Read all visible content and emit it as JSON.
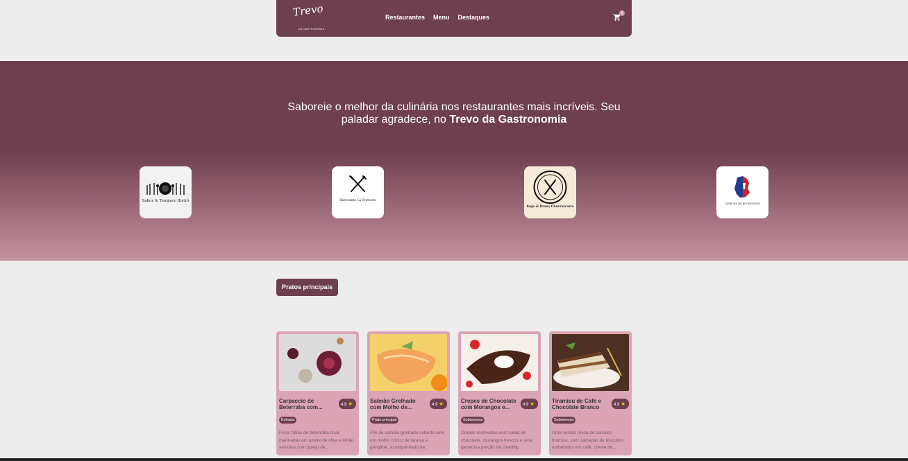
{
  "brand": {
    "script": "Trevo",
    "subtitle": "DA GASTRONOMIA"
  },
  "nav": {
    "items": [
      "Restaurantes",
      "Menu",
      "Destaques"
    ]
  },
  "cart": {
    "count": "0"
  },
  "hero": {
    "text_prefix": "Saboreie o melhor da culinária nos restaurantes mais incríveis. Seu paladar agradece, no ",
    "text_bold": "Trevo da Gastronomia"
  },
  "restaurants": [
    {
      "name": "Sabor & Tempero Bistrô"
    },
    {
      "name": "Ristorante La Trattoria"
    },
    {
      "name": "Fogo & Brasa Churrascaria"
    },
    {
      "name": "SAVEURS DE BOURGOGNE"
    }
  ],
  "section_tab": {
    "label": "Pratos principais"
  },
  "dishes": [
    {
      "title": "Carpaccio de Beterraba com...",
      "rating": "4.9",
      "tag": "Entrada",
      "desc": "Finas fatias de beterraba crua marinadas em azeite de oliva e limão, servidas com queijo de..."
    },
    {
      "title": "Salmão Grelhado com Molho de...",
      "rating": "4.9",
      "tag": "Prato principal",
      "desc": "Filé de salmão grelhado coberto com um molho cítrico de laranja e gengibre, acompanhado de..."
    },
    {
      "title": "Crepes de Chocolate com Morangos e...",
      "rating": "4.9",
      "tag": "Sobremesa",
      "desc": "Crepes recheados com calda de chocolate, morangos frescos e uma generosa porção de chantilly."
    },
    {
      "title": "Tiramisu de Café e Chocolate Branco",
      "rating": "4.9",
      "tag": "Sobremesa",
      "desc": "Uma versão única do clássico tiramisu, com camadas de biscoitos embebidos em café, creme de..."
    }
  ]
}
